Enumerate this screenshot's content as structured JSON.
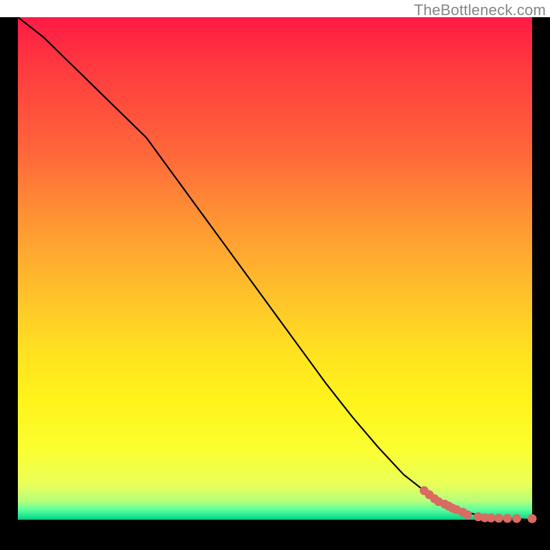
{
  "watermark": "TheBottleneck.com",
  "colors": {
    "frame": "#000000",
    "curve": "#000000",
    "marker": "#d96b62"
  },
  "chart_data": {
    "type": "line",
    "title": "",
    "xlabel": "",
    "ylabel": "",
    "xlim": [
      0,
      100
    ],
    "ylim": [
      0,
      100
    ],
    "series": [
      {
        "name": "curve",
        "x": [
          0,
          5,
          10,
          15,
          20,
          25,
          30,
          35,
          40,
          45,
          50,
          55,
          60,
          65,
          70,
          75,
          80,
          82,
          84,
          86,
          88,
          90,
          92,
          94,
          96,
          98,
          100
        ],
        "y": [
          100,
          96,
          91,
          86,
          81,
          76,
          69,
          62,
          55,
          48,
          41,
          34,
          27,
          20.5,
          14.5,
          9,
          5,
          3.8,
          2.8,
          2.0,
          1.3,
          0.8,
          0.5,
          0.3,
          0.2,
          0.1,
          0.0
        ]
      }
    ],
    "markers": {
      "name": "scatter-points",
      "x": [
        79.0,
        80.0,
        81.0,
        81.8,
        83.0,
        83.8,
        84.5,
        85.3,
        86.5,
        87.4,
        89.5,
        90.8,
        92.0,
        93.5,
        95.2,
        97.0,
        100.0
      ],
      "y": [
        5.8,
        5.0,
        4.2,
        3.6,
        3.1,
        2.7,
        2.3,
        2.0,
        1.5,
        1.0,
        0.6,
        0.4,
        0.35,
        0.3,
        0.28,
        0.25,
        0.22
      ]
    },
    "gradient_bands": [
      {
        "y": 100,
        "color": "#ff1a45"
      },
      {
        "y": 50,
        "color": "#ffb82c"
      },
      {
        "y": 20,
        "color": "#fff31a"
      },
      {
        "y": 3,
        "color": "#b8ff7a"
      },
      {
        "y": 0,
        "color": "#00c985"
      }
    ]
  }
}
